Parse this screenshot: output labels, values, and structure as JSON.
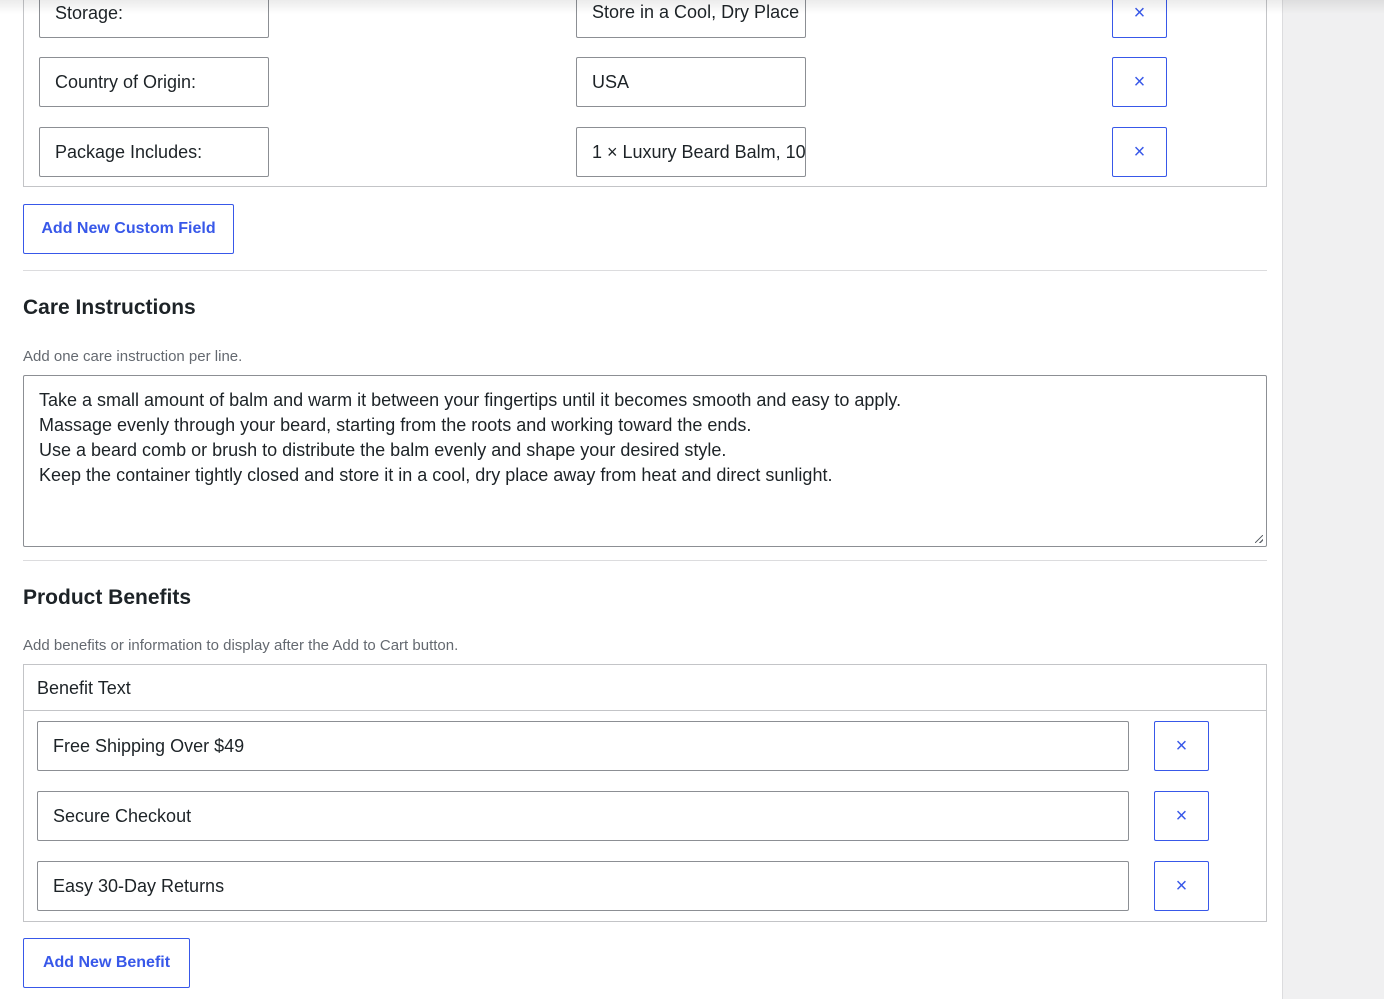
{
  "custom_fields": {
    "rows": [
      {
        "key": "Storage:",
        "value": "Store in a Cool, Dry Place"
      },
      {
        "key": "Country of Origin:",
        "value": "USA"
      },
      {
        "key": "Package Includes:",
        "value": "1 × Luxury Beard Balm, 10"
      }
    ],
    "remove_label": "×",
    "add_button": "Add New Custom Field"
  },
  "care": {
    "title": "Care Instructions",
    "description": "Add one care instruction per line.",
    "lines": [
      "Take a small amount of balm and warm it between your fingertips until it becomes smooth and easy to apply.",
      "Massage evenly through your beard, starting from the roots and working toward the ends.",
      "Use a beard comb or brush to distribute the balm evenly and shape your desired style.",
      "Keep the container tightly closed and store it in a cool, dry place away from heat and direct sunlight."
    ]
  },
  "benefits": {
    "title": "Product Benefits",
    "description": "Add benefits or information to display after the Add to Cart button.",
    "column_header": "Benefit Text",
    "rows": [
      "Free Shipping Over $49",
      "Secure Checkout",
      "Easy 30-Day Returns"
    ],
    "remove_label": "×",
    "add_button": "Add New Benefit"
  },
  "colors": {
    "accent": "#3858e9",
    "border": "#8c8f94",
    "muted_text": "#646970"
  }
}
